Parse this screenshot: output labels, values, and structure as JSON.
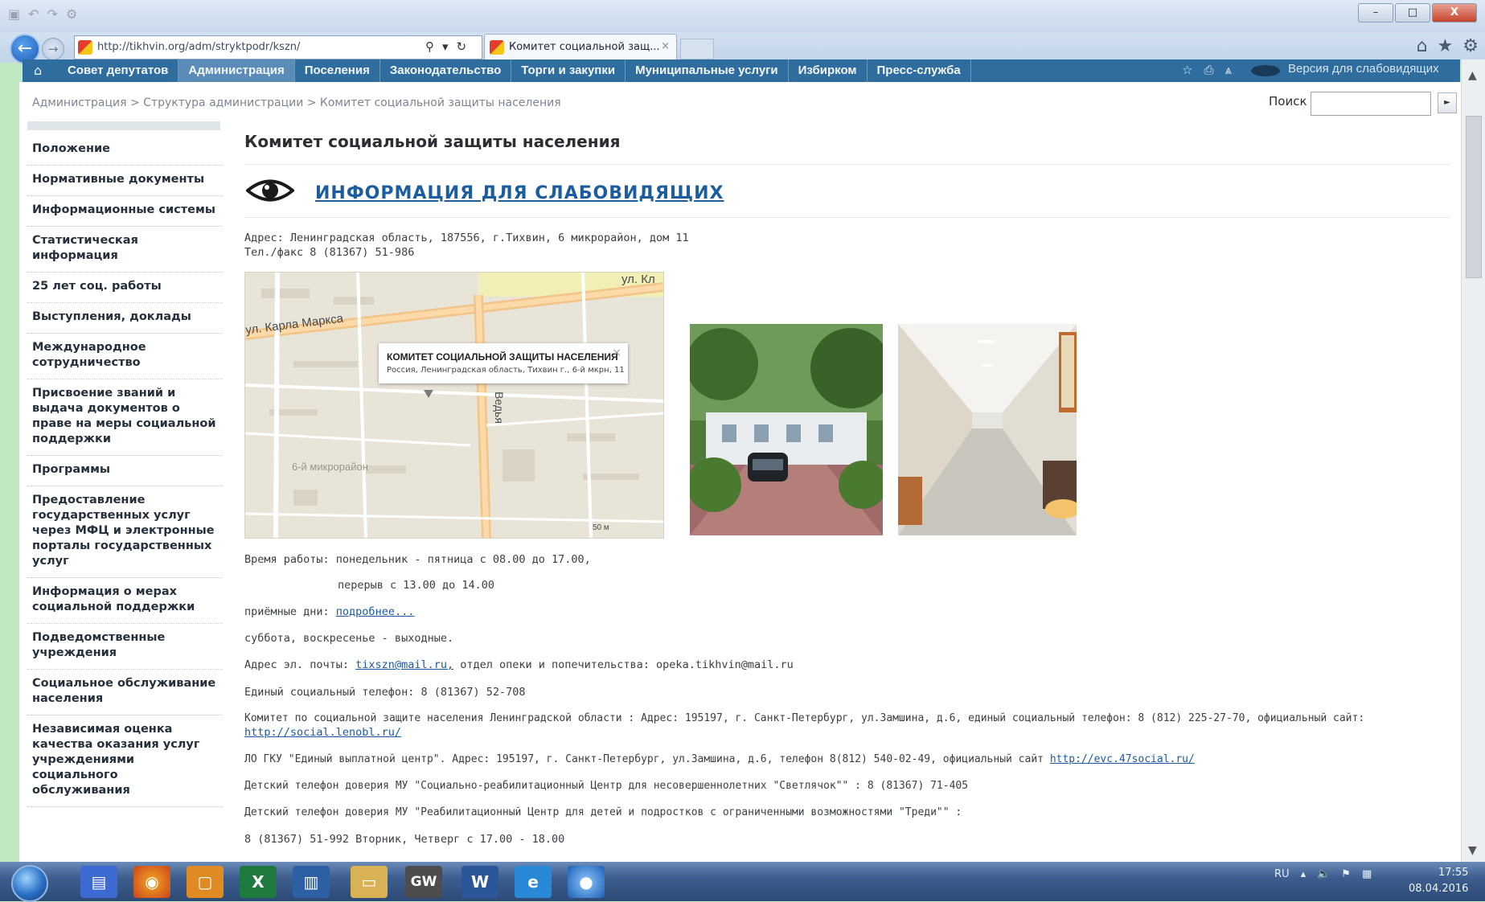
{
  "browser": {
    "url": "http://tikhvin.org/adm/stryktpodr/kszn/",
    "tab_title": "Комитет социальной защ...",
    "tab_close": "×",
    "window_buttons": {
      "minimize": "–",
      "maximize": "□",
      "close": "X"
    }
  },
  "site_nav": {
    "items": [
      {
        "label": "Совет депутатов",
        "active": false
      },
      {
        "label": "Администрация",
        "active": true
      },
      {
        "label": "Поселения",
        "active": false
      },
      {
        "label": "Законодательство",
        "active": false
      },
      {
        "label": "Торги и закупки",
        "active": false
      },
      {
        "label": "Муниципальные услуги",
        "active": false
      },
      {
        "label": "Избирком",
        "active": false
      },
      {
        "label": "Пресс-служба",
        "active": false
      }
    ],
    "visually_impaired_label": "Версия для слабовидящих"
  },
  "breadcrumb": "Администрация > Структура администрации > Комитет социальной защиты населения",
  "search": {
    "label": "Поиск",
    "value": "",
    "button": "►"
  },
  "sidebar": {
    "items": [
      "Положение",
      "Нормативные документы",
      "Информационные системы",
      "Статистическая информация",
      "25 лет соц. работы",
      "Выступления, доклады",
      "Международное сотрудничество",
      "Присвоение званий и выдача документов о праве на меры социальной поддержки",
      "Программы",
      "Предоставление государственных услуг через МФЦ и электронные порталы государственных услуг",
      "Информация о мерах социальной поддержки",
      "Подведомственные учреждения",
      "Социальное обслуживание населения",
      "Независимая оценка качества оказания услуг учреждениями социального обслуживания"
    ]
  },
  "content": {
    "title": "Комитет социальной защиты населения",
    "vis_link": "ИНФОРМАЦИЯ ДЛЯ СЛАБОВИДЯЩИХ",
    "address": "Адрес: Ленинградская область, 187556, г.Тихвин, 6 микрорайон, дом 11",
    "phone": "Тел./факс 8 (81367) 51-986",
    "map": {
      "popup_title": "КОМИТЕТ СОЦИАЛЬНОЙ ЗАЩИТЫ НАСЕЛЕНИЯ",
      "popup_address": "Россия, Ленинградская область, Тихвин г., 6-й мкрн, 11",
      "street1": "ул. Карла Маркса",
      "street2": "ул. Кл",
      "street3": "Ведья",
      "district": "6-й микрорайон",
      "scale": "50 м"
    },
    "hours_line": "Время работы: понедельник - пятница с 08.00 до 17.00,",
    "break_line": "перерыв с 13.00 до 14.00",
    "reception_prefix": "приёмные дни: ",
    "reception_link": "подробнее...",
    "weekend_line": "суббота, воскресенье - выходные.",
    "email_prefix": "Адрес эл. почты: ",
    "email_link": "tixszn@mail.ru,",
    "email_suffix": " отдел опеки и попечительства: opeka.tikhvin@mail.ru",
    "social_phone": "Единый социальный телефон:  8 (81367) 52-708",
    "committee_line": "Комитет по социальной защите населения Ленинградской области : Адрес: 195197, г. Санкт-Петербург, ул.Замшина, д.6, единый социальный телефон: 8 (812) 225-27-70, официальный сайт:",
    "committee_link": "http://social.lenobl.ru/",
    "gku_line": "ЛО ГКУ \"Единый выплатной центр\". Адрес: 195197, г. Санкт-Петербург, ул.Замшина, д.6, телефон 8(812) 540-02-49, официальный сайт ",
    "gku_link": "http://evc.47social.ru/",
    "child_line1": "Детский телефон доверия МУ \"Социально-реабилитационный Центр для несовершеннолетних \"Светлячок\"\" : 8 (81367) 71-405",
    "child_line2": "Детский телефон доверия МУ \"Реабилитационный Центр для детей и подростков с ограниченными возможностями \"Треди\"\" :",
    "child_line3": "8 (81367) 51-992   Вторник, Четверг с 17.00 - 18.00"
  },
  "taskbar": {
    "apps": [
      "save-app",
      "firefox",
      "openoffice",
      "excel",
      "network",
      "explorer",
      "gw",
      "word",
      "internet-explorer",
      "globe"
    ],
    "tray_lang": "RU",
    "time": "17:55",
    "date": "08.04.2016"
  },
  "colors": {
    "site_nav_bg": "#2f6d9e",
    "link": "#1b5d9e",
    "page_frame": "#bfe9c0"
  }
}
